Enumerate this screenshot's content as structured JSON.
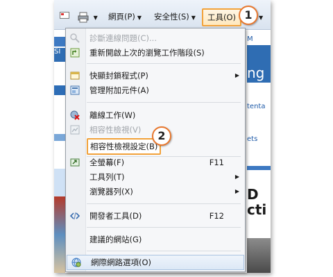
{
  "toolbar": {
    "page_label": "網頁(P)",
    "safety_label": "安全性(S)",
    "tools_label": "工具(O)",
    "help_label": "?"
  },
  "background": {
    "right_fragments": [
      "M",
      "ng",
      "tenta",
      "ets",
      "D",
      "cti"
    ],
    "left_fragment": "SI"
  },
  "menu": {
    "items": [
      {
        "label": "診斷連線問題(C)...",
        "disabled": true,
        "icon": "diagnose-icon"
      },
      {
        "label": "重新開啟上次的瀏覽工作階段(S)",
        "icon": "reopen-session-icon"
      },
      {
        "label": "快顯封鎖程式(P)",
        "submenu": true,
        "icon": "popup-blocker-icon"
      },
      {
        "label": "管理附加元件(A)",
        "icon": "addons-icon"
      },
      {
        "label": "離線工作(W)",
        "icon": "work-offline-icon"
      },
      {
        "label": "相容性檢視(V)",
        "disabled": true,
        "icon": "compat-view-icon"
      },
      {
        "label": "相容性檢視設定(B)"
      },
      {
        "label": "全螢幕(F)",
        "shortcut": "F11",
        "icon": "fullscreen-icon"
      },
      {
        "label": "工具列(T)",
        "submenu": true
      },
      {
        "label": "瀏覽器列(X)",
        "submenu": true
      },
      {
        "label": "開發者工具(D)",
        "shortcut": "F12",
        "icon": "developer-tools-icon"
      },
      {
        "label": "建議的網站(G)"
      },
      {
        "label": "網際網路選項(O)",
        "icon": "internet-options-icon"
      }
    ]
  },
  "callouts": [
    "1",
    "2"
  ],
  "colors": {
    "highlight": "#f2a23a",
    "badge_ring": "#e8772d"
  }
}
